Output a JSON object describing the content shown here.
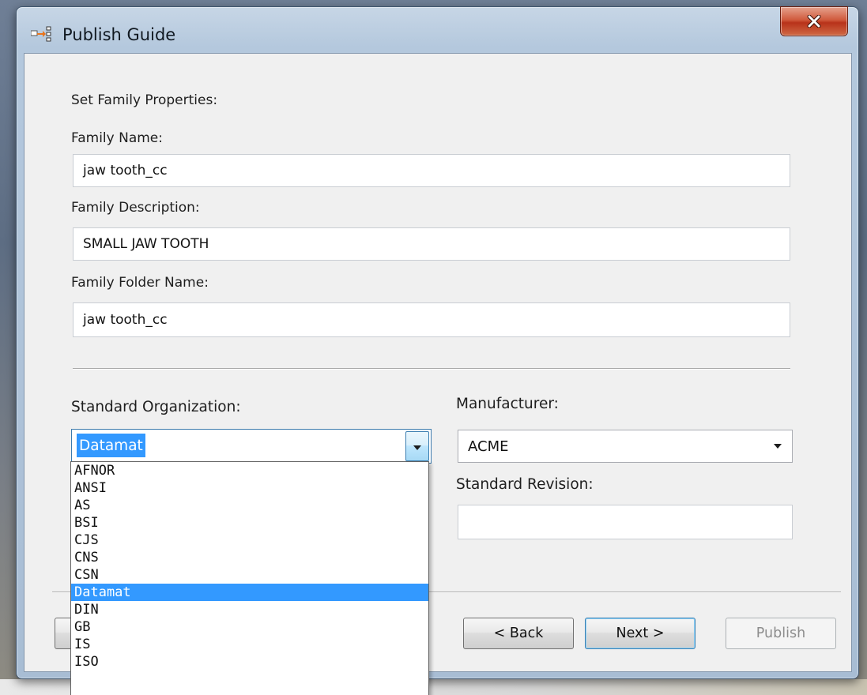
{
  "window": {
    "title": "Publish Guide"
  },
  "form": {
    "heading": "Set Family Properties:",
    "family_name_label": "Family Name:",
    "family_name_value": "jaw tooth_cc",
    "family_description_label": "Family Description:",
    "family_description_value": "SMALL JAW TOOTH",
    "family_folder_label": "Family Folder Name:",
    "family_folder_value": "jaw tooth_cc",
    "standard_org_label": "Standard Organization:",
    "standard_org_value": "Datamat",
    "manufacturer_label": "Manufacturer:",
    "manufacturer_value": "ACME",
    "standard_revision_label": "Standard Revision:",
    "standard_revision_value": ""
  },
  "dropdown": {
    "options": [
      "AFNOR",
      "ANSI",
      "AS",
      "BSI",
      "CJS",
      "CNS",
      "CSN",
      "Datamat",
      "DIN",
      "GB",
      "IS",
      "ISO"
    ],
    "selected_index": 7
  },
  "buttons": {
    "back": "< Back",
    "next": "Next >",
    "publish": "Publish"
  },
  "icons": {
    "app": "publish-arrow-icon",
    "close": "close-icon",
    "dropdown": "chevron-down-icon"
  },
  "colors": {
    "selection": "#3399ff",
    "close_button": "#c8462b",
    "default_button_border": "#3c7fb1"
  }
}
